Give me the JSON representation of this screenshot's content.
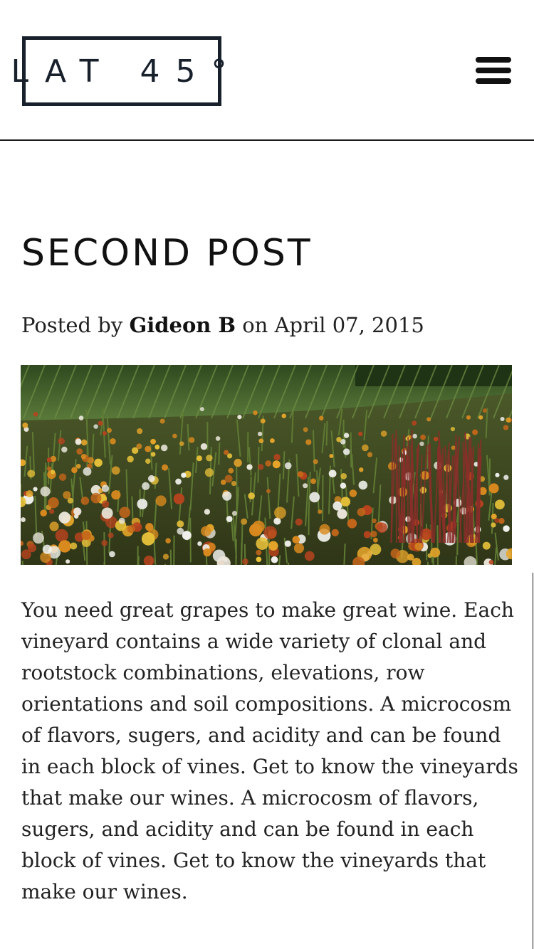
{
  "header": {
    "logo_text": "LAT 45°",
    "menu_icon": "hamburger-menu-icon"
  },
  "post": {
    "title": "SECOND POST",
    "meta_prefix": "Posted by ",
    "author": "Gideon B",
    "meta_middle": " on ",
    "date": "April 07, 2015",
    "body": "You need great grapes to make great wine. Each vineyard contains a wide variety of clonal and rootstock combinations, elevations, row orientations and soil compositions. A microcosm of flavors, sugers, and acidity and can be found in each block of vines. Get to know the vineyards that make our wines. A microcosm of flavors, sugers, and acidity and can be found in each block of vines. Get to know the vineyards that make our wines."
  },
  "colors": {
    "logo": "#17202b",
    "text": "#222222",
    "vineyard_green": "#3f6a2a",
    "flower_orange": "#d98a1f",
    "flower_white": "#f2f2ee"
  }
}
